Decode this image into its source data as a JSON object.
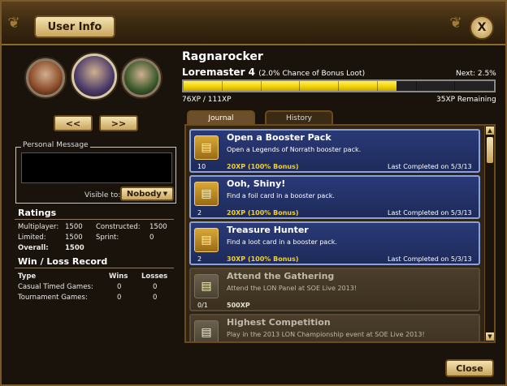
{
  "window": {
    "title_tab": "User Info",
    "close_glyph": "X"
  },
  "avatars": [
    {
      "name": "avatar-1",
      "color": "#8a4a28"
    },
    {
      "name": "avatar-2",
      "color": "#4a3a6a"
    },
    {
      "name": "avatar-3",
      "color": "#3a5a2a"
    }
  ],
  "nav": {
    "prev": "<<",
    "next": ">>"
  },
  "personal_message": {
    "label": "Personal Message",
    "value": "",
    "visible_label": "Visible to:",
    "visible_value": "Nobody"
  },
  "ratings": {
    "heading": "Ratings",
    "multiplayer_label": "Multiplayer:",
    "multiplayer": "1500",
    "constructed_label": "Constructed:",
    "constructed": "1500",
    "limited_label": "Limited:",
    "limited": "1500",
    "sprint_label": "Sprint:",
    "sprint": "0",
    "overall_label": "Overall:",
    "overall": "1500"
  },
  "record": {
    "heading": "Win / Loss Record",
    "col_type": "Type",
    "col_wins": "Wins",
    "col_losses": "Losses",
    "rows": [
      {
        "type": "Casual Timed Games:",
        "wins": "0",
        "losses": "0"
      },
      {
        "type": "Tournament Games:",
        "wins": "0",
        "losses": "0"
      }
    ]
  },
  "player": {
    "name": "Ragnarocker",
    "level_title": "Loremaster 4",
    "bonus_text": "(2.0% Chance of Bonus Loot)",
    "next": "Next: 2.5%",
    "xp_fraction": 0.687,
    "xp_current": "76XP / 111XP",
    "xp_remaining": "35XP Remaining"
  },
  "tabs": {
    "journal": "Journal",
    "history": "History"
  },
  "journal": [
    {
      "title": "Open a Booster Pack",
      "desc": "Open a Legends of Norrath booster pack.",
      "count": "10",
      "xp": "20XP (100% Bonus)",
      "date": "Last Completed on 5/3/13",
      "done": true
    },
    {
      "title": "Ooh, Shiny!",
      "desc": "Find a foil card in a booster pack.",
      "count": "2",
      "xp": "20XP (100% Bonus)",
      "date": "Last Completed on 5/3/13",
      "done": true
    },
    {
      "title": "Treasure Hunter",
      "desc": "Find a loot card in a booster pack.",
      "count": "2",
      "xp": "30XP (100% Bonus)",
      "date": "Last Completed on 5/3/13",
      "done": true
    },
    {
      "title": "Attend the Gathering",
      "desc": "Attend the LON Panel at SOE Live 2013!",
      "count": "0/1",
      "xp": "500XP",
      "date": "",
      "done": false
    },
    {
      "title": "Highest Competition",
      "desc": "Play in the 2013 LON Championship event at SOE Live 2013!",
      "count": "",
      "xp": "",
      "date": "",
      "done": false
    }
  ],
  "footer": {
    "close": "Close"
  }
}
